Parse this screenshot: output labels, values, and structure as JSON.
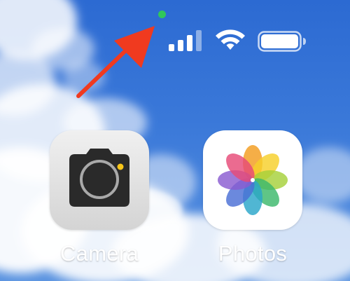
{
  "status_bar": {
    "privacy_indicator_color": "#30c75a",
    "signal_icon": "cellular-signal-icon",
    "signal_bars_active": 3,
    "signal_bars_total": 4,
    "wifi_icon": "wifi-icon",
    "battery_icon": "battery-icon",
    "battery_level": 1.0
  },
  "annotation": {
    "arrow_color": "#f03a1f",
    "points_to": "privacy-indicator-dot"
  },
  "apps": [
    {
      "label": "Camera",
      "icon": "camera-icon"
    },
    {
      "label": "Photos",
      "icon": "photos-flower-icon"
    }
  ],
  "colors": {
    "sky": "#2f6bd0",
    "camera_bg": "#e6e6e6",
    "camera_body": "#2a2a2a",
    "camera_flash": "#f7c519"
  }
}
